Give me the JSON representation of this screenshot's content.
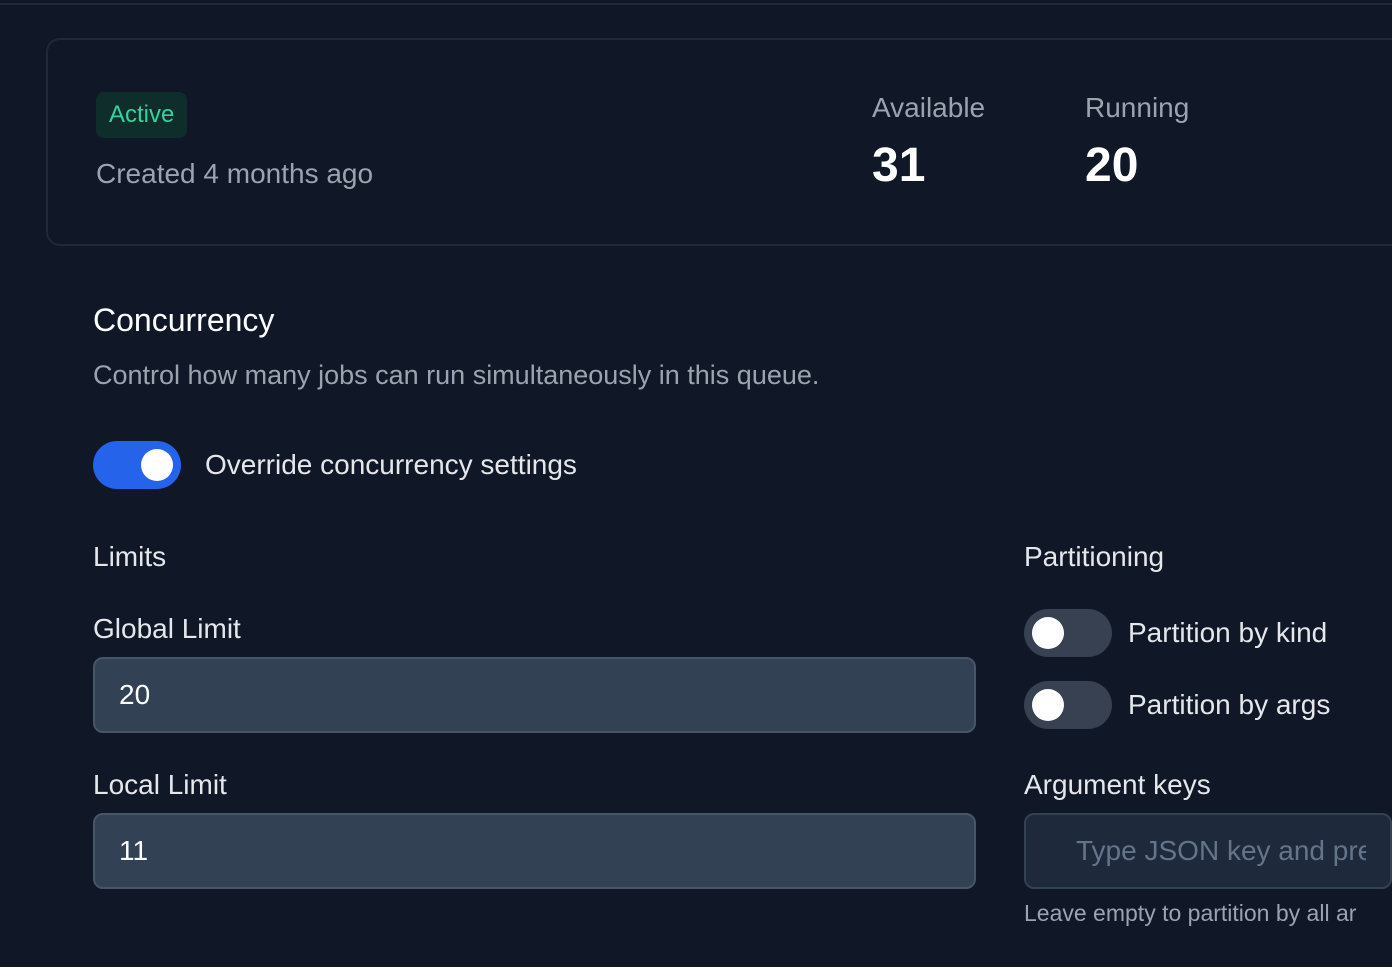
{
  "summary": {
    "status": "Active",
    "created": "Created 4 months ago",
    "stats": [
      {
        "label": "Available",
        "value": "31"
      },
      {
        "label": "Running",
        "value": "20"
      }
    ]
  },
  "concurrency": {
    "title": "Concurrency",
    "description": "Control how many jobs can run simultaneously in this queue.",
    "override": {
      "label": "Override concurrency settings",
      "enabled": true
    },
    "limits": {
      "heading": "Limits",
      "global_label": "Global Limit",
      "global_value": "20",
      "local_label": "Local Limit",
      "local_value": "11"
    },
    "partitioning": {
      "heading": "Partitioning",
      "by_kind": {
        "label": "Partition by kind",
        "enabled": false
      },
      "by_args": {
        "label": "Partition by args",
        "enabled": false
      },
      "argument_keys_label": "Argument keys",
      "argument_keys_placeholder": "Type JSON key and press",
      "helper": "Leave empty to partition by all ar"
    }
  },
  "colors": {
    "background": "#101828",
    "accent": "#2563eb",
    "active_badge_text": "#34d399"
  }
}
